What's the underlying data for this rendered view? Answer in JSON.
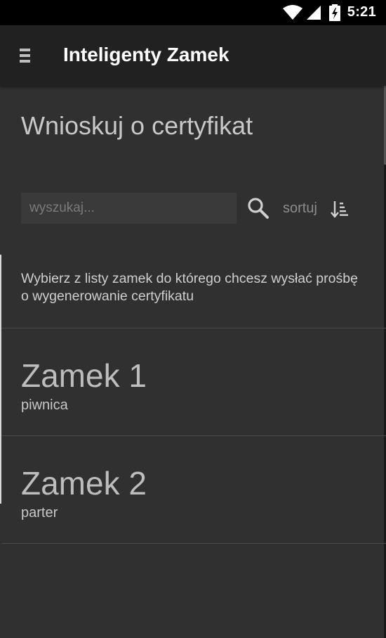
{
  "status_bar": {
    "time": "5:21",
    "icons": [
      "wifi-icon",
      "cell-signal-icon",
      "battery-charging-icon"
    ]
  },
  "app_bar": {
    "title": "Inteligenty Zamek",
    "menu_icon": "hamburger-menu-icon"
  },
  "page": {
    "heading": "Wnioskuj o certyfikat",
    "search": {
      "placeholder": "wyszukaj...",
      "value": "",
      "icon": "search-icon"
    },
    "sort": {
      "label": "sortuj",
      "icon": "sort-icon"
    },
    "instructions": "Wybierz z listy zamek do którego chcesz wysłać prośbę o wygenerowanie certyfikatu",
    "locks": [
      {
        "name": "Zamek 1",
        "location": "piwnica"
      },
      {
        "name": "Zamek 2",
        "location": "parter"
      }
    ]
  },
  "colors": {
    "background": "#303030",
    "app_bar": "#212121",
    "status_bar": "#000000",
    "search_field": "#3a3a3a",
    "divider": "#4a4a4a"
  }
}
